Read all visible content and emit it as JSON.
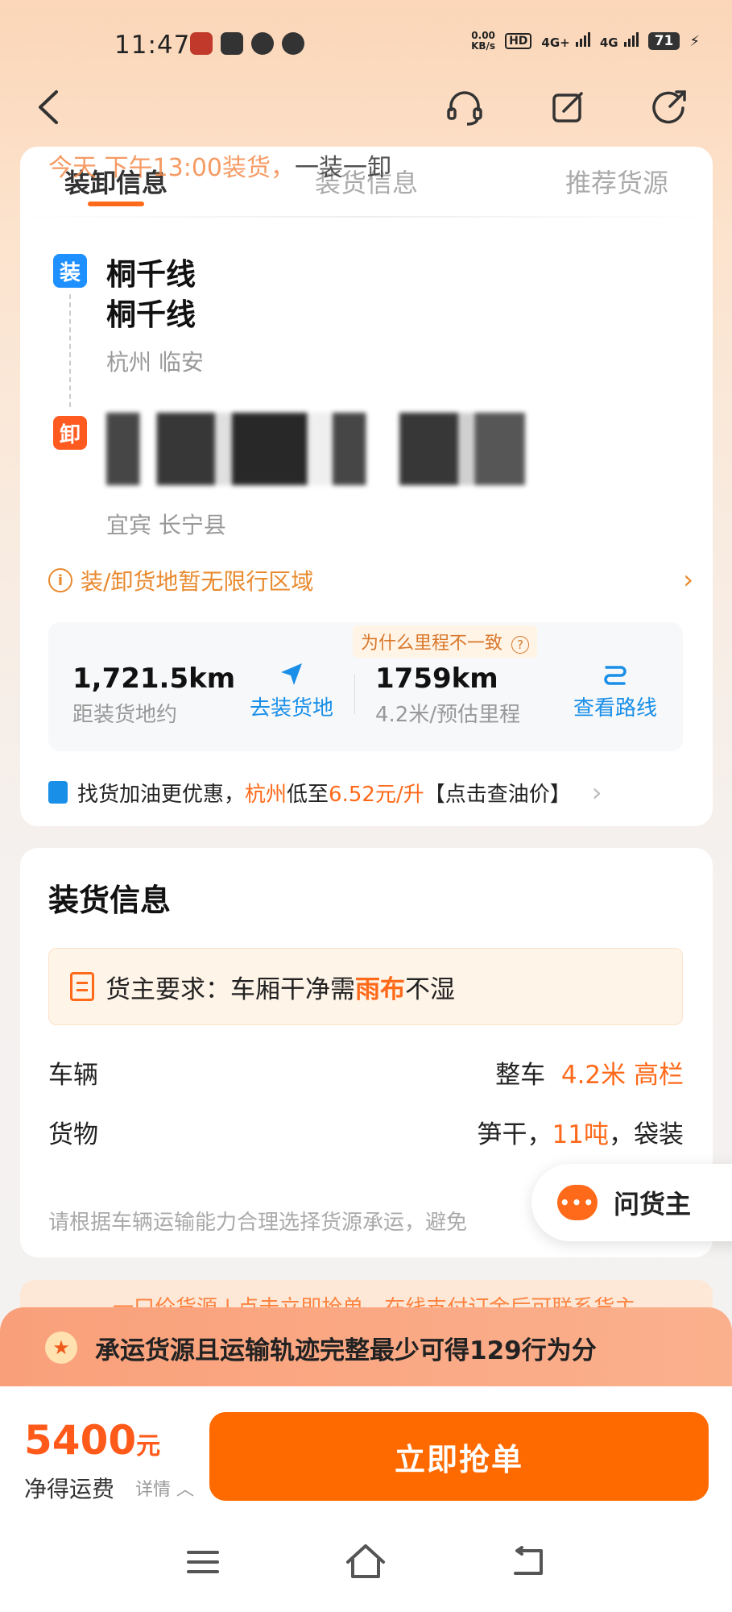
{
  "status": {
    "time": "11:47",
    "speed_top": "0.00",
    "speed_bottom": "KB/s",
    "hd": "HD",
    "sig1": "4G+",
    "sig2": "4G",
    "battery": "71"
  },
  "header": {
    "notice_orange": "今天 下午13:00装货，",
    "notice_dark": "一装一卸"
  },
  "tabs": [
    {
      "label": "装卸信息"
    },
    {
      "label": "装货信息"
    },
    {
      "label": "推荐货源"
    }
  ],
  "route": {
    "load_badge": "装",
    "load_line1": "桐千线",
    "load_line2": "桐千线",
    "load_area": "杭州 临安",
    "unload_badge": "卸",
    "unload_area": "宜宾 长宁县"
  },
  "restrict": {
    "icon": "i",
    "text": "装/卸货地暂无限行区域"
  },
  "distance": {
    "why_label": "为什么里程不一致",
    "why_icon": "?",
    "to_load_value": "1,721.5km",
    "to_load_label": "距装货地约",
    "go_label": "去装货地",
    "route_value": "1759km",
    "route_label": "4.2米/预估里程",
    "view_route_label": "查看路线"
  },
  "fuel": {
    "part1": "找货加油更优惠，",
    "city": "杭州",
    "part2": "低至",
    "price": "6.52元/升",
    "part3": "【点击查油价】"
  },
  "cargo": {
    "title": "装货信息",
    "req_prefix": "货主要求：车厢干净需",
    "req_highlight": "雨布",
    "req_suffix": "不湿",
    "vehicle_label": "车辆",
    "vehicle_type": "整车",
    "vehicle_spec": "4.2米 高栏",
    "goods_label": "货物",
    "goods_name": "笋干，",
    "goods_weight": "11吨",
    "goods_pack": "，袋装",
    "hint": "请根据车辆运输能力合理选择货源承运，避免"
  },
  "ask": {
    "icon_text": "•••",
    "label": "问货主"
  },
  "promo": {
    "text": "一口价货源 | 点击立即抢单，在线支付订金后可联系货主"
  },
  "score": {
    "text": "承运货源且运输轨迹完整最少可得129行为分"
  },
  "bottom": {
    "price": "5400",
    "price_unit": "元",
    "price_label": "净得运费",
    "detail_label": "详情",
    "grab_label": "立即抢单"
  },
  "colors": {
    "accent": "#ff6a00",
    "link": "#1a8fe8",
    "load_badge": "#1e90ff",
    "unload_badge": "#ff5a1f"
  }
}
